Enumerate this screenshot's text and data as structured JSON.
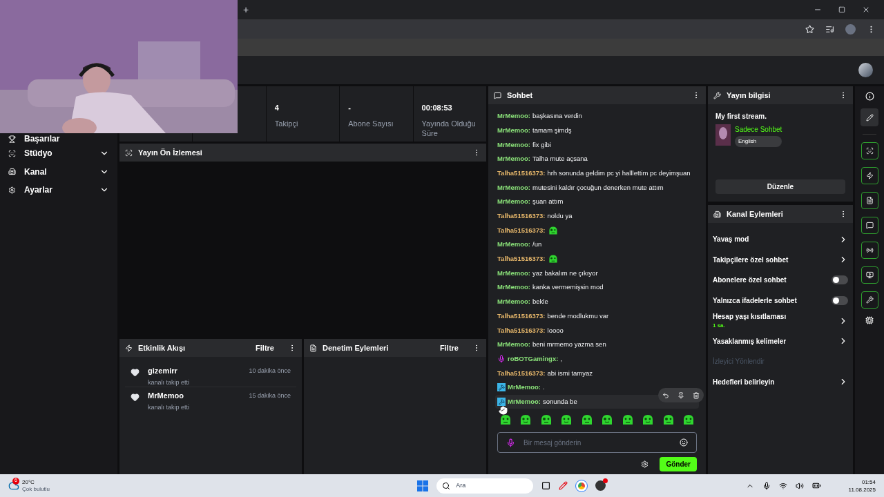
{
  "browser": {
    "new_tab": "+"
  },
  "sidebar": {
    "items": [
      {
        "label": "Başarılar",
        "kind": "link"
      },
      {
        "label": "Stüdyo",
        "kind": "group",
        "expanded": false
      },
      {
        "label": "Kanal",
        "kind": "group",
        "expanded": false
      },
      {
        "label": "Ayarlar",
        "kind": "group",
        "expanded": false
      }
    ]
  },
  "stats": [
    {
      "value": "4",
      "label": "Takipçi"
    },
    {
      "value": "-",
      "label": "Abone Sayısı"
    },
    {
      "value": "00:08:53",
      "label": "Yayında Olduğu Süre"
    }
  ],
  "preview": {
    "title": "Yayın Ön İzlemesi"
  },
  "activity": {
    "title": "Etkinlik Akışı",
    "filter": "Filtre",
    "events": [
      {
        "user": "gizemirr",
        "action": "kanalı takip etti",
        "time": "10 dakika önce"
      },
      {
        "user": "MrMemoo",
        "action": "kanalı takip etti",
        "time": "15 dakika önce"
      }
    ]
  },
  "moderation": {
    "title": "Denetim Eylemleri",
    "filter": "Filtre"
  },
  "chat": {
    "title": "Sohbet",
    "messages": [
      {
        "user": "MrMemoo:",
        "color": "#8be37a",
        "kind": "plain",
        "emote": false,
        "hovered": false,
        "text": "başkasına verdin"
      },
      {
        "user": "MrMemoo:",
        "color": "#8be37a",
        "kind": "plain",
        "emote": false,
        "hovered": false,
        "text": "tamam şimdş"
      },
      {
        "user": "MrMemoo:",
        "color": "#8be37a",
        "kind": "plain",
        "emote": false,
        "hovered": false,
        "text": "fix gibi"
      },
      {
        "user": "MrMemoo:",
        "color": "#8be37a",
        "kind": "plain",
        "emote": false,
        "hovered": false,
        "text": "Talha mute açsana"
      },
      {
        "user": "Talha51516373:",
        "color": "#e8b86b",
        "kind": "plain",
        "emote": false,
        "hovered": false,
        "text": "hrh sonunda geldim pc yi halllettim pc deyimşuan"
      },
      {
        "user": "MrMemoo:",
        "color": "#8be37a",
        "kind": "plain",
        "emote": false,
        "hovered": false,
        "text": "mutesini kaldır çocuğun denerken mute attım"
      },
      {
        "user": "MrMemoo:",
        "color": "#8be37a",
        "kind": "plain",
        "emote": false,
        "hovered": false,
        "text": "şuan attım"
      },
      {
        "user": "Talha51516373:",
        "color": "#e8b86b",
        "kind": "plain",
        "emote": false,
        "hovered": false,
        "text": "noldu ya"
      },
      {
        "user": "Talha51516373:",
        "color": "#e8b86b",
        "kind": "plain",
        "emote": true,
        "hovered": false
      },
      {
        "user": "MrMemoo:",
        "color": "#8be37a",
        "kind": "plain",
        "emote": false,
        "hovered": false,
        "text": "/un"
      },
      {
        "user": "Talha51516373:",
        "color": "#e8b86b",
        "kind": "plain",
        "emote": true,
        "hovered": false
      },
      {
        "user": "MrMemoo:",
        "color": "#8be37a",
        "kind": "plain",
        "emote": false,
        "hovered": false,
        "text": "yaz bakalım ne çıkıyor"
      },
      {
        "user": "MrMemoo:",
        "color": "#8be37a",
        "kind": "plain",
        "emote": false,
        "hovered": false,
        "text": "kanka vermemişsin mod"
      },
      {
        "user": "MrMemoo:",
        "color": "#8be37a",
        "kind": "plain",
        "emote": false,
        "hovered": false,
        "text": "bekle"
      },
      {
        "user": "Talha51516373:",
        "color": "#e8b86b",
        "kind": "plain",
        "emote": false,
        "hovered": false,
        "text": "bende modlukmu var"
      },
      {
        "user": "Talha51516373:",
        "color": "#e8b86b",
        "kind": "plain",
        "emote": false,
        "hovered": false,
        "text": "loooo"
      },
      {
        "user": "MrMemoo:",
        "color": "#8be37a",
        "kind": "plain",
        "emote": false,
        "hovered": false,
        "text": "beni mrmemo yazma sen"
      },
      {
        "user": "roBOTGamingx:",
        "color": "#8be37a",
        "kind": "mic",
        "emote": false,
        "hovered": false,
        "text": ","
      },
      {
        "user": "Talha51516373:",
        "color": "#e8b86b",
        "kind": "plain",
        "emote": false,
        "hovered": false,
        "text": "abi ismi tamyaz"
      },
      {
        "user": "MrMemoo:",
        "color": "#8be37a",
        "kind": "mod",
        "emote": false,
        "hovered": false,
        "text": "."
      },
      {
        "user": "MrMemoo:",
        "color": "#8be37a",
        "kind": "mod",
        "emote": false,
        "hovered": true,
        "text": "sonunda be"
      }
    ],
    "placeholder": "Bir mesaj gönderin",
    "send": "Gönder"
  },
  "stream_info": {
    "title": "Yayın bilgisi",
    "stream_title": "My first stream.",
    "category": "Sadece Sohbet",
    "tag": "English",
    "edit": "Düzenle"
  },
  "channel_actions": {
    "title": "Kanal Eylemleri",
    "items": [
      {
        "label": "Yavaş mod",
        "kind": "link"
      },
      {
        "label": "Takipçilere özel sohbet",
        "kind": "link"
      },
      {
        "label": "Abonelere özel sohbet",
        "kind": "toggle",
        "on": false
      },
      {
        "label": "Yalnızca ifadelerle sohbet",
        "kind": "toggle",
        "on": false
      },
      {
        "label": "Hesap yaşı kısıtlaması",
        "kind": "link",
        "sub": "1 sa."
      },
      {
        "label": "Yasaklanmış kelimeler",
        "kind": "link"
      },
      {
        "label": "İzleyici Yönlendir",
        "kind": "disabled"
      },
      {
        "label": "Hedefleri belirleyin",
        "kind": "link"
      }
    ]
  },
  "taskbar": {
    "weather_badge": "6",
    "temperature": "20°C",
    "condition": "Çok bulutlu",
    "search": "Ara",
    "time": "01:54",
    "date": "11.08.2025"
  }
}
